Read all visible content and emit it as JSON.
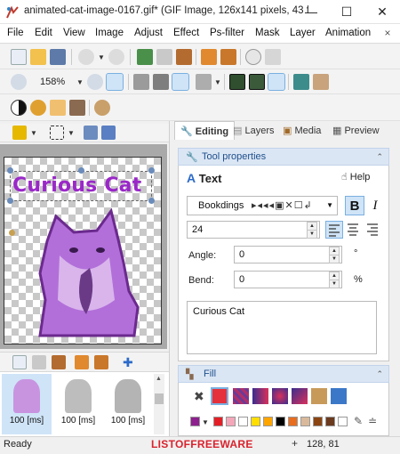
{
  "window": {
    "title": "animated-cat-image-0167.gif* (GIF Image, 126x141 pixels, 43 f...",
    "minimize": "—",
    "maximize": "☐",
    "close": "✕"
  },
  "menu": {
    "items": [
      "File",
      "Edit",
      "View",
      "Image",
      "Adjust",
      "Effect",
      "Ps-filter",
      "Mask",
      "Layer",
      "Animation"
    ],
    "close": "×"
  },
  "toolbar": {
    "zoom": "158%"
  },
  "canvas": {
    "text": "Curious Cat"
  },
  "frames": [
    {
      "label": "100 [ms]"
    },
    {
      "label": "100 [ms]"
    },
    {
      "label": "100 [ms]"
    }
  ],
  "tabs": [
    "Editing",
    "Layers",
    "Media",
    "Preview"
  ],
  "tool_properties": {
    "title": "Tool properties",
    "tool_name": "Text",
    "help": "Help",
    "font": "Bookdings",
    "bold": "B",
    "italic": "I",
    "size": "24",
    "angle_label": "Angle:",
    "angle_value": "0",
    "angle_unit": "°",
    "bend_label": "Bend:",
    "bend_value": "0",
    "bend_unit": "%",
    "text_value": "Curious Cat"
  },
  "fill": {
    "title": "Fill",
    "palette": [
      "#8e1f8e",
      "#e21f26",
      "#f4a7b9",
      "#ffffff",
      "#ffde00",
      "#ffa500",
      "#000000",
      "#e86d1f",
      "#d9b99b",
      "#8b4513",
      "#6b3a1f"
    ]
  },
  "status": {
    "text": "Ready",
    "brand": "LISTOFFREEWARE",
    "coords": "128, 81"
  }
}
